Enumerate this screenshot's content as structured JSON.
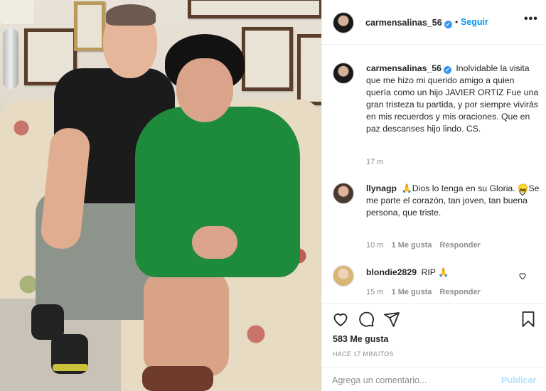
{
  "photo": {
    "description_icon": "photo-image"
  },
  "header": {
    "username": "carmensalinas_56",
    "verified_icon": "verified-badge-icon",
    "separator": "•",
    "follow_label": "Seguir",
    "more_label": "•••"
  },
  "caption": {
    "username": "carmensalinas_56",
    "text": "Inolvidable la visita que me hizo mi querido amigo a quien quería como un hijo JAVIER ORTIZ Fue una gran tristeza tu partida, y por siempre vivirás en mis recuerdos y mis oraciones. Que en paz descanses hijo lindo. CS.",
    "time": "17 m"
  },
  "comments": [
    {
      "username": "llynagp",
      "emoji1": "🙏",
      "text_a": "Dios lo tenga en su Gloria.",
      "emoji2": "😞",
      "text_b": "Se me parte el corazón, tan joven, tan buena persona, que triste.",
      "time": "10 m",
      "likes": "1 Me gusta",
      "reply": "Responder"
    },
    {
      "username": "blondie2829",
      "text": "RIP",
      "emoji1": "🙏",
      "time": "15 m",
      "likes": "1 Me gusta",
      "reply": "Responder"
    }
  ],
  "actions": {
    "like_icon": "heart-icon",
    "comment_icon": "comment-icon",
    "share_icon": "share-icon",
    "save_icon": "bookmark-icon",
    "likes_count": "583 Me gusta",
    "timestamp": "HACE 17 MINUTOS"
  },
  "add_comment": {
    "placeholder": "Agrega un comentario...",
    "publish_label": "Publicar"
  },
  "colors": {
    "link": "#0095f6",
    "verified": "#3897f0",
    "muted": "#8e8e8e",
    "publish_disabled": "#b2dffc"
  }
}
